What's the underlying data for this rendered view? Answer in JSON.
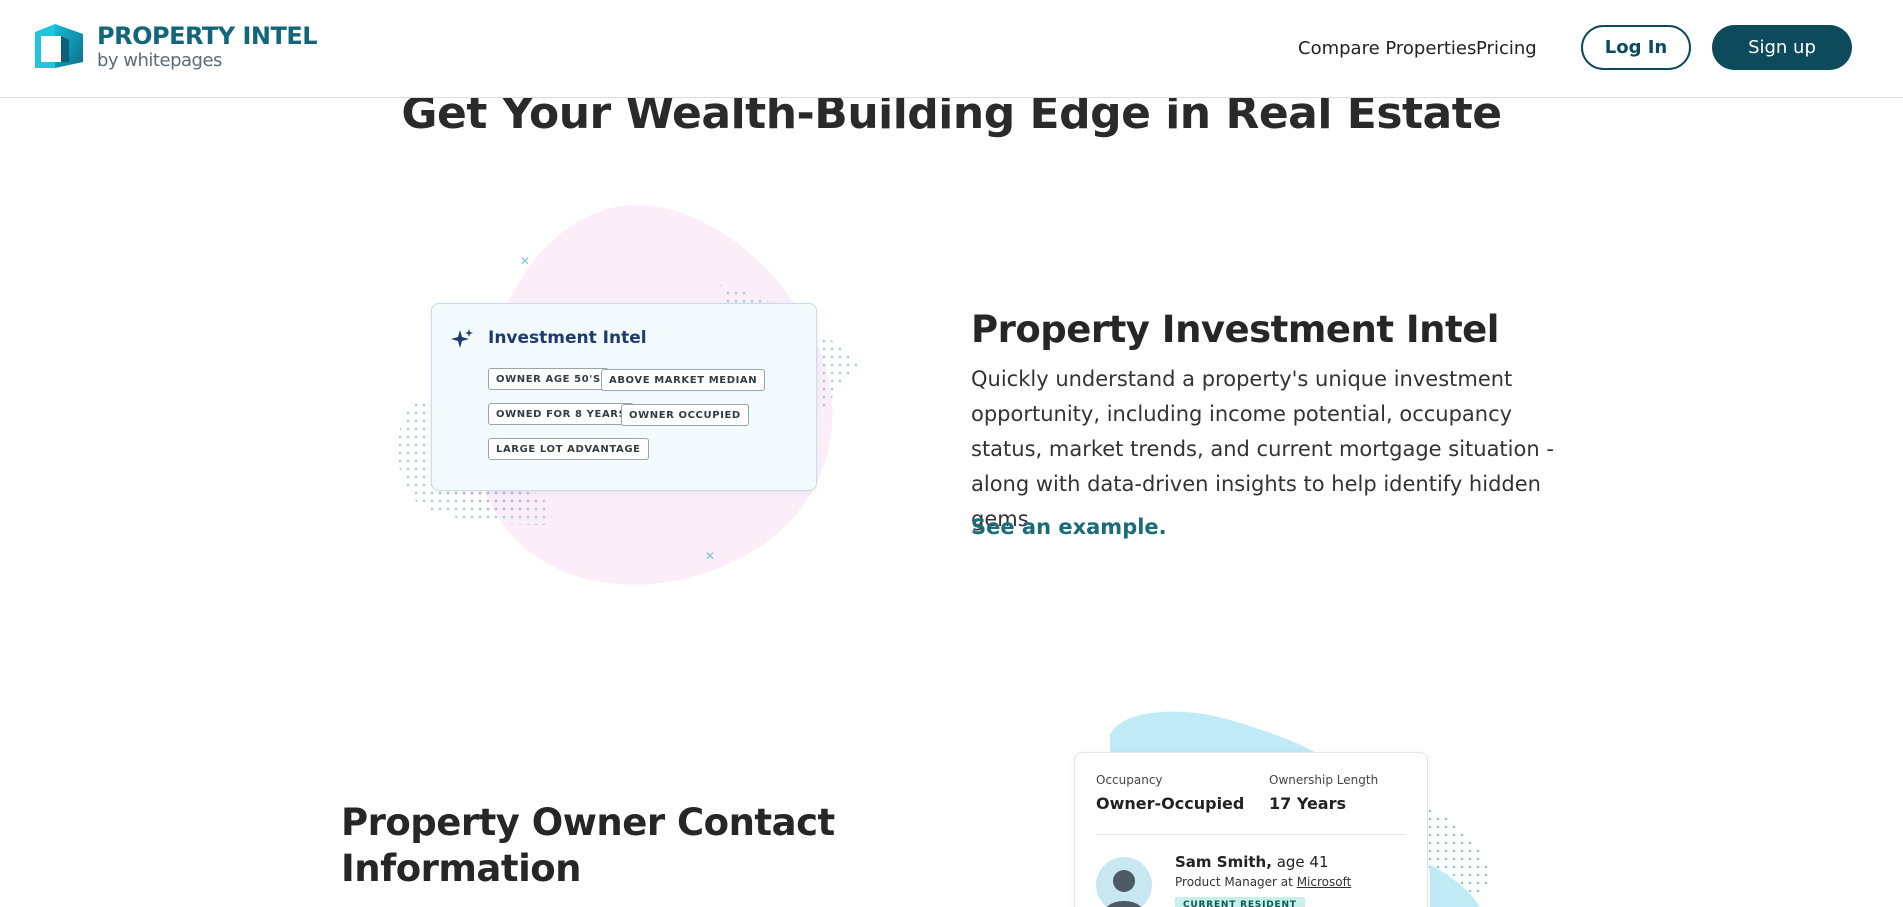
{
  "header": {
    "logo_title": "PROPERTY INTEL",
    "logo_sub": "by whitepages",
    "nav": {
      "compare": "Compare Properties",
      "pricing": "Pricing",
      "login": "Log In",
      "signup": "Sign up"
    }
  },
  "hero": {
    "title": "Get Your Wealth-Building Edge in Real Estate"
  },
  "investment_card": {
    "icon": "sparkle-icon",
    "title": "Investment Intel",
    "tags": [
      "OWNER AGE 50'S",
      "ABOVE MARKET MEDIAN",
      "OWNED FOR 8 YEARS",
      "OWNER OCCUPIED",
      "LARGE LOT ADVANTAGE"
    ]
  },
  "section1": {
    "title": "Property Investment Intel",
    "description": "Quickly understand a property's unique investment opportunity, including income potential, occupancy status, market trends, and current mortgage situation - along with data-driven insights to help identify hidden gems.",
    "link": "See an example."
  },
  "section2": {
    "title": "Property Owner Contact Information"
  },
  "owner_card": {
    "occupancy_label": "Occupancy",
    "occupancy_value": "Owner-Occupied",
    "ownership_label": "Ownership Length",
    "ownership_value": "17 Years",
    "name": "Sam Smith,",
    "age": "age 41",
    "job_prefix": "Product Manager at",
    "employer": "Microsoft",
    "badge": "CURRENT RESIDENT"
  },
  "colors": {
    "brand_dark": "#0c4a5c",
    "brand_teal": "#12667a",
    "link": "#1b6b78",
    "blob_pink": "#fbeef9",
    "blob_blue": "#bfeaf6"
  }
}
